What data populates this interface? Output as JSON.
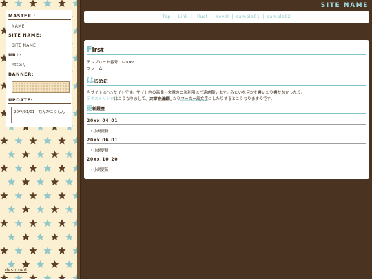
{
  "header": {
    "site_title": "SITE NAME"
  },
  "nav": {
    "items": [
      "Top",
      "Link",
      "Illust",
      "Novel",
      "sample01",
      "sample02"
    ],
    "separator": "|"
  },
  "sidebar": {
    "master_label": "MASTER :",
    "master_value": "NAME",
    "sitename_label": "SITE NAME:",
    "sitename_value": "SITE NAME",
    "url_label": "URL:",
    "url_value": "http://",
    "banner_label": "BANNER:",
    "update_label": "UPDATE:",
    "update_value": "20**/01/01　なんかこうしん",
    "designed_label": "designed"
  },
  "content": {
    "first_heading_initial": "F",
    "first_heading_rest": "irst",
    "first_line1": "テンプレート番号：f-006c",
    "first_line2": "フレーム",
    "intro_heading_initial": "は",
    "intro_heading_rest": "じめに",
    "intro_line1": "当サイトは○○サイトです。サイト内の画像・文章の二次利用はご遠慮願います。みたいな何かを書いたり書かなかったり。",
    "intro_link": "テキストリンク",
    "intro_mid": "はこうなりまして、",
    "intro_strong": "文章を強調",
    "intro_mid2": "したり",
    "intro_marker": "マーカー風文字",
    "intro_end": "にしたりするとこうなりますのです。",
    "history_heading_initial": "更",
    "history_heading_rest": "新履歴",
    "history": [
      {
        "date": "20xx.04.01",
        "note": "・小説更新"
      },
      {
        "date": "20xx.06.01",
        "note": "・小説更新"
      },
      {
        "date": "20xx.10.20",
        "note": "・小説更新"
      }
    ]
  },
  "colors": {
    "accent": "#7fc4c8",
    "background": "#4a3320",
    "sidebar": "#fbf0d2",
    "star_dark": "#5a3e26",
    "star_teal": "#8fc7cc"
  },
  "icons": {
    "pattern": "star-icon"
  }
}
